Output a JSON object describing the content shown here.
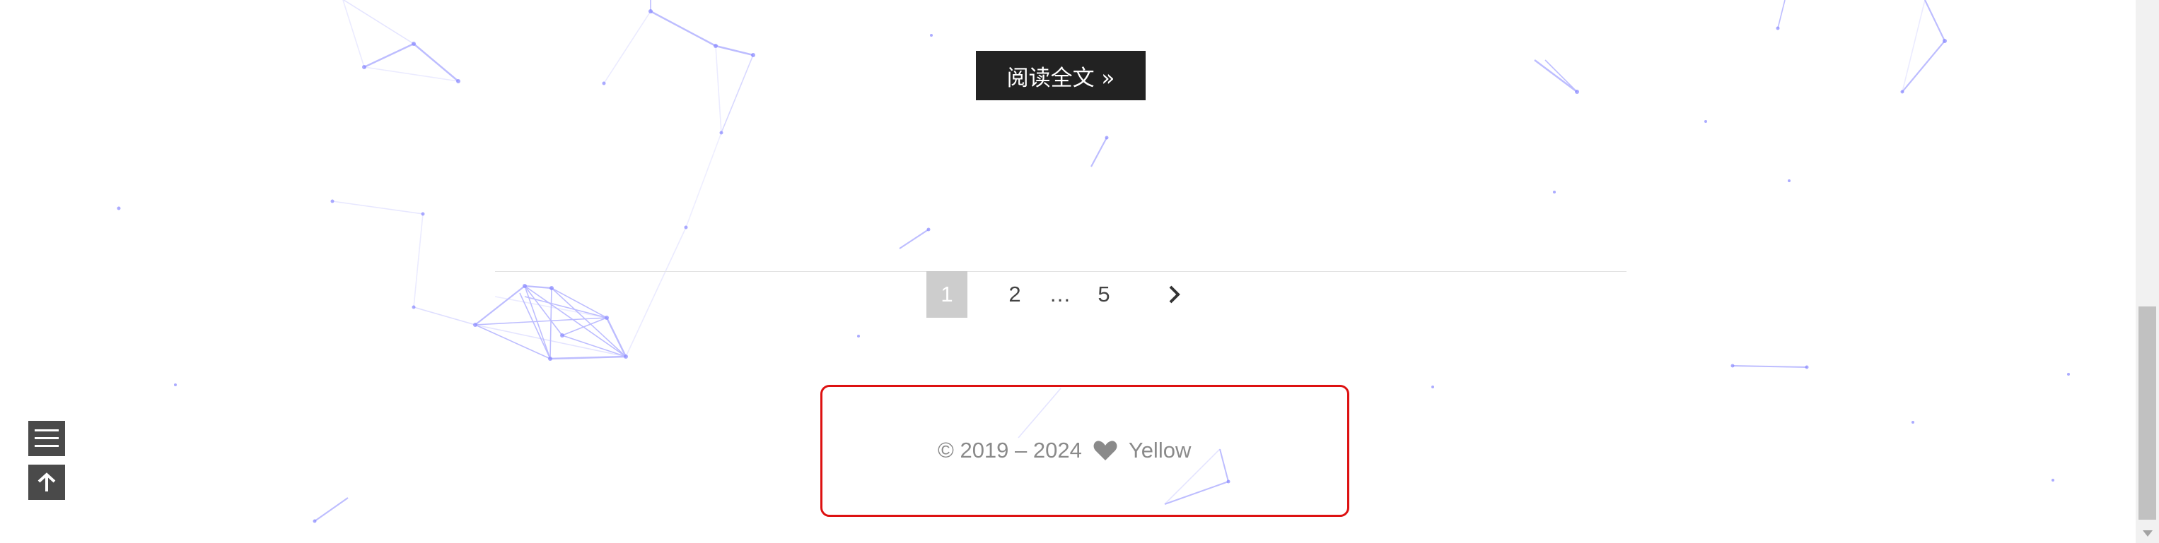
{
  "article": {
    "read_more_label": "阅读全文 »"
  },
  "pagination": {
    "pages": [
      "1",
      "2",
      "…",
      "5"
    ],
    "current": "1",
    "next_icon": "chevron-right-icon"
  },
  "footer": {
    "copyright": "© 2019 – 2024",
    "heart_icon": "heart-icon",
    "author": "Yellow",
    "highlight_color": "#dd1111"
  },
  "side_buttons": {
    "menu_icon": "menu-icon",
    "top_icon": "arrow-up-icon"
  },
  "colors": {
    "particle": "#7b7bff",
    "button_bg": "#222222"
  }
}
